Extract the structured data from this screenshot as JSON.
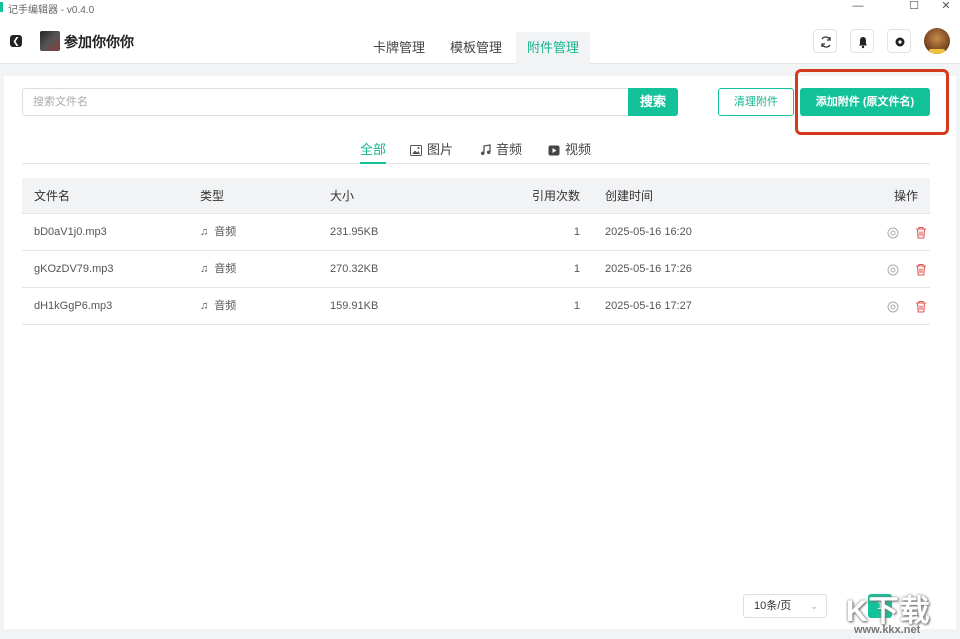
{
  "window": {
    "title": "记手编辑器 - v0.4.0",
    "controls": {
      "minimize": "—",
      "maximize": "☐",
      "close": "✕"
    }
  },
  "header": {
    "back_icon": "chevron-left-icon",
    "project_name": "参加你你你",
    "tabs": [
      {
        "label": "卡牌管理",
        "active": false
      },
      {
        "label": "模板管理",
        "active": false
      },
      {
        "label": "附件管理",
        "active": true
      }
    ],
    "actions": [
      "refresh-icon",
      "bell-icon",
      "gear-icon"
    ]
  },
  "toolbar": {
    "search_placeholder": "搜索文件名",
    "search_label": "搜索",
    "clean_label": "清理附件",
    "add_label": "添加附件 (原文件名)"
  },
  "filters": [
    {
      "label": "全部",
      "icon": "",
      "active": true
    },
    {
      "label": "图片",
      "icon": "image-icon",
      "active": false
    },
    {
      "label": "音频",
      "icon": "music-icon",
      "active": false
    },
    {
      "label": "视频",
      "icon": "video-icon",
      "active": false
    }
  ],
  "table": {
    "columns": [
      "文件名",
      "类型",
      "大小",
      "引用次数",
      "创建时间",
      "操作"
    ],
    "rows": [
      {
        "name": "bD0aV1j0.mp3",
        "type": "音频",
        "size": "231.95KB",
        "refs": "1",
        "created": "2025-05-16 16:20"
      },
      {
        "name": "gKOzDV79.mp3",
        "type": "音频",
        "size": "270.32KB",
        "refs": "1",
        "created": "2025-05-16 17:26"
      },
      {
        "name": "dH1kGgP6.mp3",
        "type": "音频",
        "size": "159.91KB",
        "refs": "1",
        "created": "2025-05-16 17:27"
      }
    ]
  },
  "pagination": {
    "page_size": "10条/页",
    "current_page": "1"
  },
  "watermark": {
    "logo": "K下载",
    "url": "www.kkx.net"
  },
  "colors": {
    "accent": "#14c29a",
    "highlight": "#d23a1e",
    "delete": "#e0554f"
  }
}
